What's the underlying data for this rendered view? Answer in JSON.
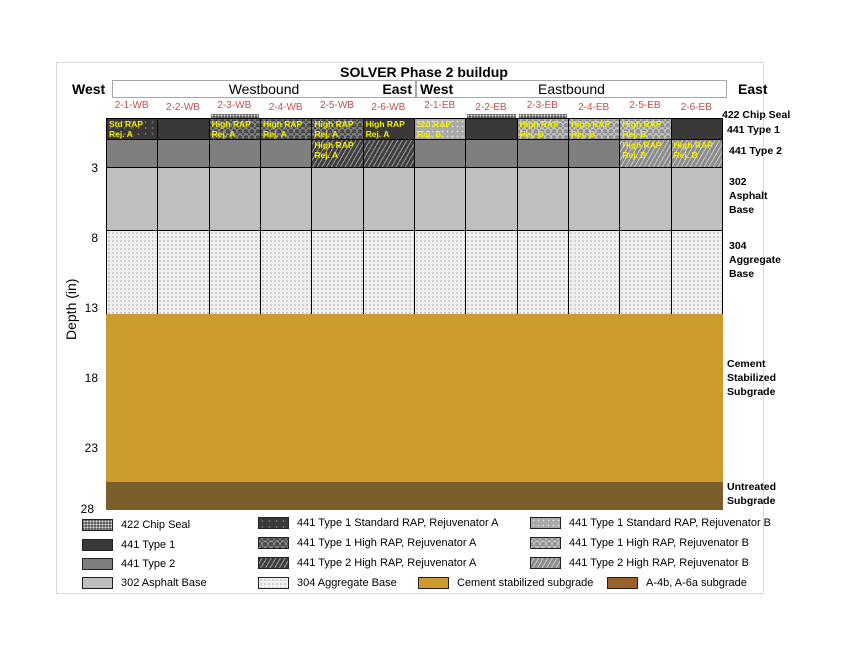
{
  "title": "SOLVER Phase 2 buildup",
  "direction_labels": {
    "left": "West",
    "right": "East",
    "mid_east": "East",
    "mid_west": "West"
  },
  "bound_labels": {
    "westbound": "Westbound",
    "eastbound": "Eastbound"
  },
  "columns": [
    "2-1-WB",
    "2-2-WB",
    "2-3-WB",
    "2-4-WB",
    "2-5-WB",
    "2-6-WB",
    "2-1-EB",
    "2-2-EB",
    "2-3-EB",
    "2-4-EB",
    "2-5-EB",
    "2-6-EB"
  ],
  "y_axis": {
    "label": "Depth (in)",
    "ticks": [
      "3",
      "8",
      "13",
      "18",
      "23",
      "28"
    ],
    "range": [
      0,
      28
    ]
  },
  "chart_data": {
    "type": "table",
    "title": "SOLVER Phase 2 buildup",
    "ylabel": "Depth (in)",
    "ylim": [
      0,
      28
    ],
    "layers_depth_in": [
      {
        "name": "441 Type 1",
        "top": 0,
        "bottom": 1.5
      },
      {
        "name": "441 Type 2",
        "top": 1.5,
        "bottom": 3.5
      },
      {
        "name": "302 Asphalt Base",
        "top": 3.5,
        "bottom": 8
      },
      {
        "name": "304 Aggregate Base",
        "top": 8,
        "bottom": 14
      },
      {
        "name": "Cement Stabilized Subgrade",
        "top": 14,
        "bottom": 26
      },
      {
        "name": "Untreated Subgrade",
        "top": 26,
        "bottom": 28
      }
    ],
    "chip_seal_columns": [
      "2-3-WB",
      "2-2-EB",
      "2-3-EB"
    ],
    "type1_by_column": [
      "t1-std-a",
      "t1",
      "t1-high-a",
      "t1-high-a",
      "t1-high-a",
      "t1",
      "t1-std-b",
      "t1",
      "t1-high-b",
      "t1-high-b",
      "t1-high-b",
      "t1"
    ],
    "type2_by_column": [
      "t2",
      "t2",
      "t2",
      "t2",
      "t2-high-a",
      "t2-high-a",
      "t2",
      "t2",
      "t2",
      "t2",
      "t2-high-b",
      "t2-high-b"
    ],
    "cell_annotations": [
      {
        "column": 0,
        "layer": "type1",
        "lines": [
          "Std RAP",
          "Rej. A"
        ]
      },
      {
        "column": 2,
        "layer": "type1",
        "lines": [
          "High RAP",
          "Rej. A"
        ]
      },
      {
        "column": 3,
        "layer": "type1",
        "lines": [
          "High RAP",
          "Rej. A"
        ]
      },
      {
        "column": 4,
        "layer": "type1",
        "lines": [
          "High RAP",
          "Rej. A"
        ]
      },
      {
        "column": 4,
        "layer": "type2",
        "lines": [
          "High RAP",
          "Rej. A"
        ]
      },
      {
        "column": 5,
        "layer": "type1",
        "lines": [
          "High RAP",
          "Rej. A"
        ]
      },
      {
        "column": 6,
        "layer": "type1",
        "lines": [
          "Std RAP",
          "Rej. B"
        ]
      },
      {
        "column": 8,
        "layer": "type1",
        "lines": [
          "High RAP",
          "Rej. B"
        ]
      },
      {
        "column": 9,
        "layer": "type1",
        "lines": [
          "High RAP",
          "Rej. B"
        ]
      },
      {
        "column": 10,
        "layer": "type1",
        "lines": [
          "High RAP",
          "Rej. B"
        ]
      },
      {
        "column": 10,
        "layer": "type2",
        "lines": [
          "High RAP",
          "Rej. B"
        ]
      },
      {
        "column": 11,
        "layer": "type2",
        "lines": [
          "High RAP",
          "Rej. B"
        ]
      }
    ]
  },
  "right_labels": {
    "chip": "422 Chip Seal",
    "t1": "441 Type 1",
    "t2": "441 Type 2",
    "asphalt": [
      "302",
      "Asphalt",
      "Base"
    ],
    "aggregate": [
      "304",
      "Aggregate",
      "Base"
    ],
    "cement": [
      "Cement",
      "Stabilized",
      "Subgrade"
    ],
    "untreated": [
      "Untreated",
      "Subgrade"
    ]
  },
  "legend": [
    {
      "key": "chip",
      "label": "422 Chip Seal"
    },
    {
      "key": "t1",
      "label": "441 Type 1"
    },
    {
      "key": "t2",
      "label": "441 Type 2"
    },
    {
      "key": "302",
      "label": "302 Asphalt Base"
    },
    {
      "key": "t1-std-a",
      "label": "441 Type 1 Standard RAP, Rejuvenator A"
    },
    {
      "key": "t1-high-a",
      "label": "441 Type 1 High RAP, Rejuvenator A"
    },
    {
      "key": "t2-high-a",
      "label": "441 Type 2 High RAP, Rejuvenator A"
    },
    {
      "key": "304",
      "label": "304 Aggregate Base"
    },
    {
      "key": "t1-std-b",
      "label": "441 Type 1 Standard RAP, Rejuvenator B"
    },
    {
      "key": "t1-high-b",
      "label": "441 Type 1 High RAP, Rejuvenator B"
    },
    {
      "key": "t2-high-b",
      "label": "441 Type 2 High RAP, Rejuvenator B"
    },
    {
      "key": "cem",
      "label": "Cement stabilized subgrade"
    },
    {
      "key": "a4b",
      "label": "A-4b, A-6a subgrade"
    }
  ]
}
